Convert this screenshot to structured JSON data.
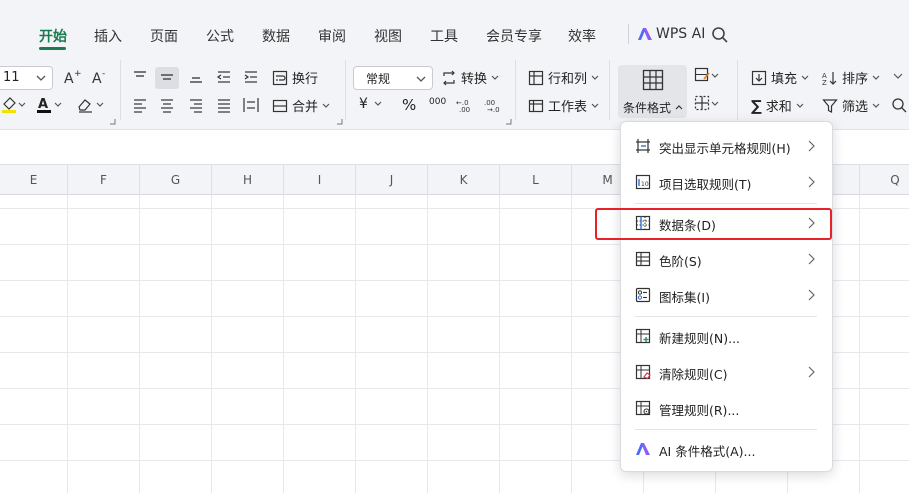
{
  "tabs": [
    {
      "label": "开始",
      "active": true
    },
    {
      "label": "插入"
    },
    {
      "label": "页面"
    },
    {
      "label": "公式"
    },
    {
      "label": "数据"
    },
    {
      "label": "审阅"
    },
    {
      "label": "视图"
    },
    {
      "label": "工具"
    },
    {
      "label": "会员专享"
    },
    {
      "label": "效率"
    }
  ],
  "ai_label": "WPS AI",
  "accent_color": "#1b7a50",
  "ribbon": {
    "font_size": "11",
    "wrap_label": "换行",
    "merge_label": "合并",
    "number_format": "常规",
    "convert_label": "转换",
    "row_col_label": "行和列",
    "sheet_label": "工作表",
    "cond_format_label": "条件格式",
    "fill_label": "填充",
    "sort_label": "排序",
    "sum_label": "求和",
    "filter_label": "筛选",
    "currency_symbol": "¥",
    "percent_symbol": "%",
    "thousands_symbol": "000"
  },
  "columns": [
    "E",
    "F",
    "G",
    "H",
    "I",
    "J",
    "K",
    "L",
    "M",
    "Q"
  ],
  "menu": {
    "items": [
      {
        "label": "突出显示单元格规则(H)",
        "icon": "highlight-rules-icon",
        "submenu": true
      },
      {
        "label": "项目选取规则(T)",
        "icon": "top-bottom-rules-icon",
        "submenu": true
      },
      {
        "label": "数据条(D)",
        "icon": "data-bar-icon",
        "submenu": true,
        "highlighted": true
      },
      {
        "label": "色阶(S)",
        "icon": "color-scale-icon",
        "submenu": true
      },
      {
        "label": "图标集(I)",
        "icon": "icon-set-icon",
        "submenu": true
      },
      {
        "label": "新建规则(N)...",
        "icon": "new-rule-icon"
      },
      {
        "label": "清除规则(C)",
        "icon": "clear-rules-icon",
        "submenu": true
      },
      {
        "label": "管理规则(R)...",
        "icon": "manage-rules-icon"
      },
      {
        "label": "AI 条件格式(A)...",
        "icon": "ai-icon"
      }
    ]
  }
}
